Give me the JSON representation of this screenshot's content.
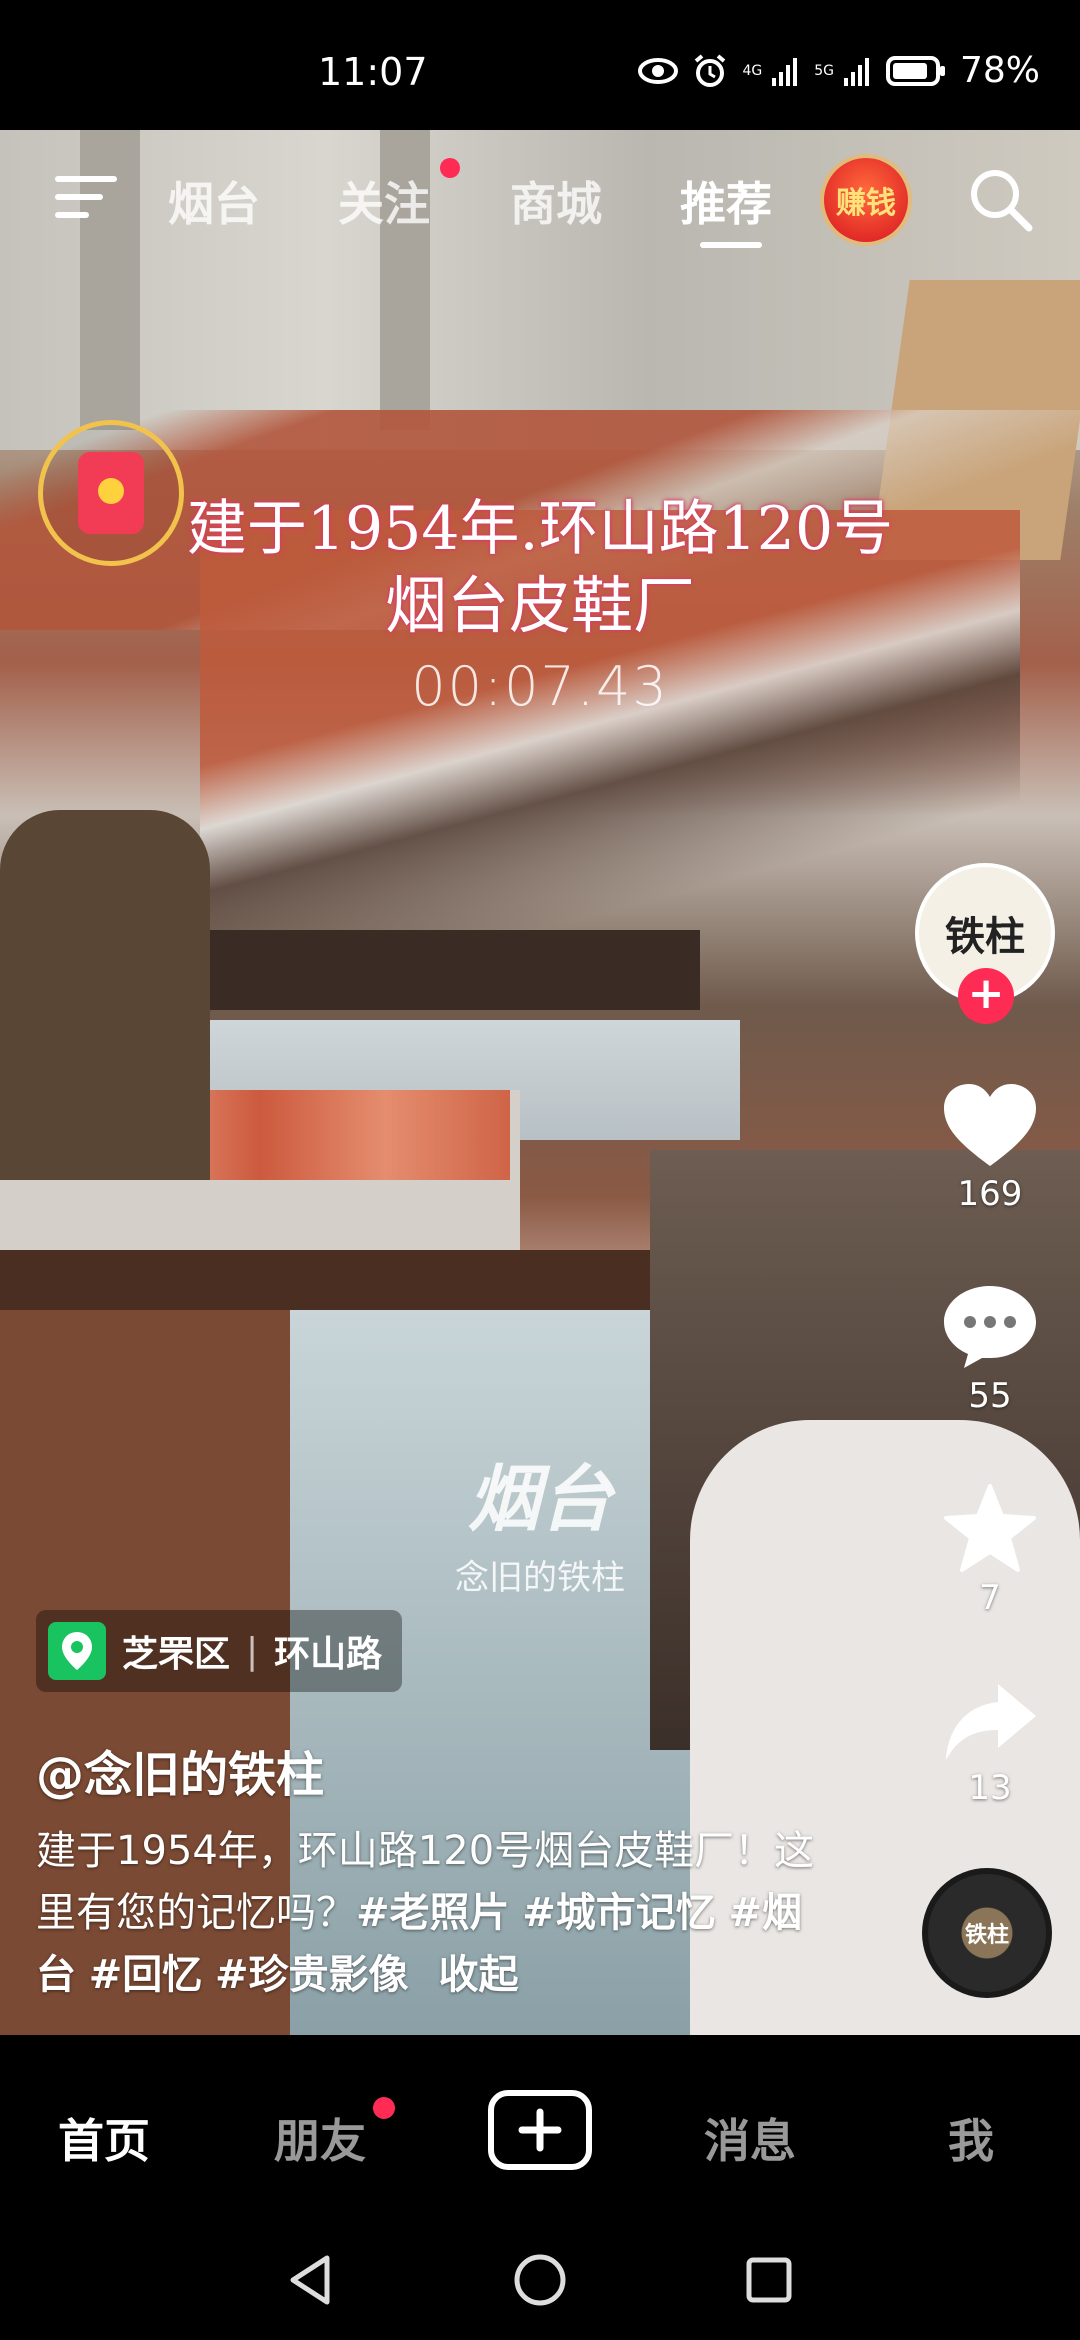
{
  "status_bar": {
    "time": "11:07",
    "signal_1_label": "4G",
    "signal_2_label": "5G",
    "battery": "78%"
  },
  "top_nav": {
    "tabs": [
      {
        "label": "烟台"
      },
      {
        "label": "关注"
      },
      {
        "label": "商城"
      },
      {
        "label": "推荐"
      }
    ],
    "earn_label": "赚钱"
  },
  "video": {
    "caption_line1": "建于1954年.环山路120号",
    "caption_line2": "烟台皮鞋厂",
    "timecode": "00:07.43",
    "watermark_logo": "烟台",
    "watermark_text": "念旧的铁柱"
  },
  "side_rail": {
    "avatar_text": "铁柱",
    "likes": "169",
    "comments": "55",
    "favorites": "7",
    "shares": "13",
    "music_text": "铁柱"
  },
  "location": {
    "district": "芝罘区",
    "separator": "|",
    "road": "环山路"
  },
  "post": {
    "author": "@念旧的铁柱",
    "text": "建于1954年，环山路120号烟台皮鞋厂！这里有您的记忆吗？",
    "tags": [
      "#老照片",
      "#城市记忆",
      "#烟台",
      "#回忆",
      "#珍贵影像"
    ],
    "collapse_label": "收起"
  },
  "bottom_nav": {
    "home": "首页",
    "friends": "朋友",
    "messages": "消息",
    "me": "我"
  },
  "colors": {
    "accent": "#fe2c55",
    "location_green": "#19c460"
  }
}
